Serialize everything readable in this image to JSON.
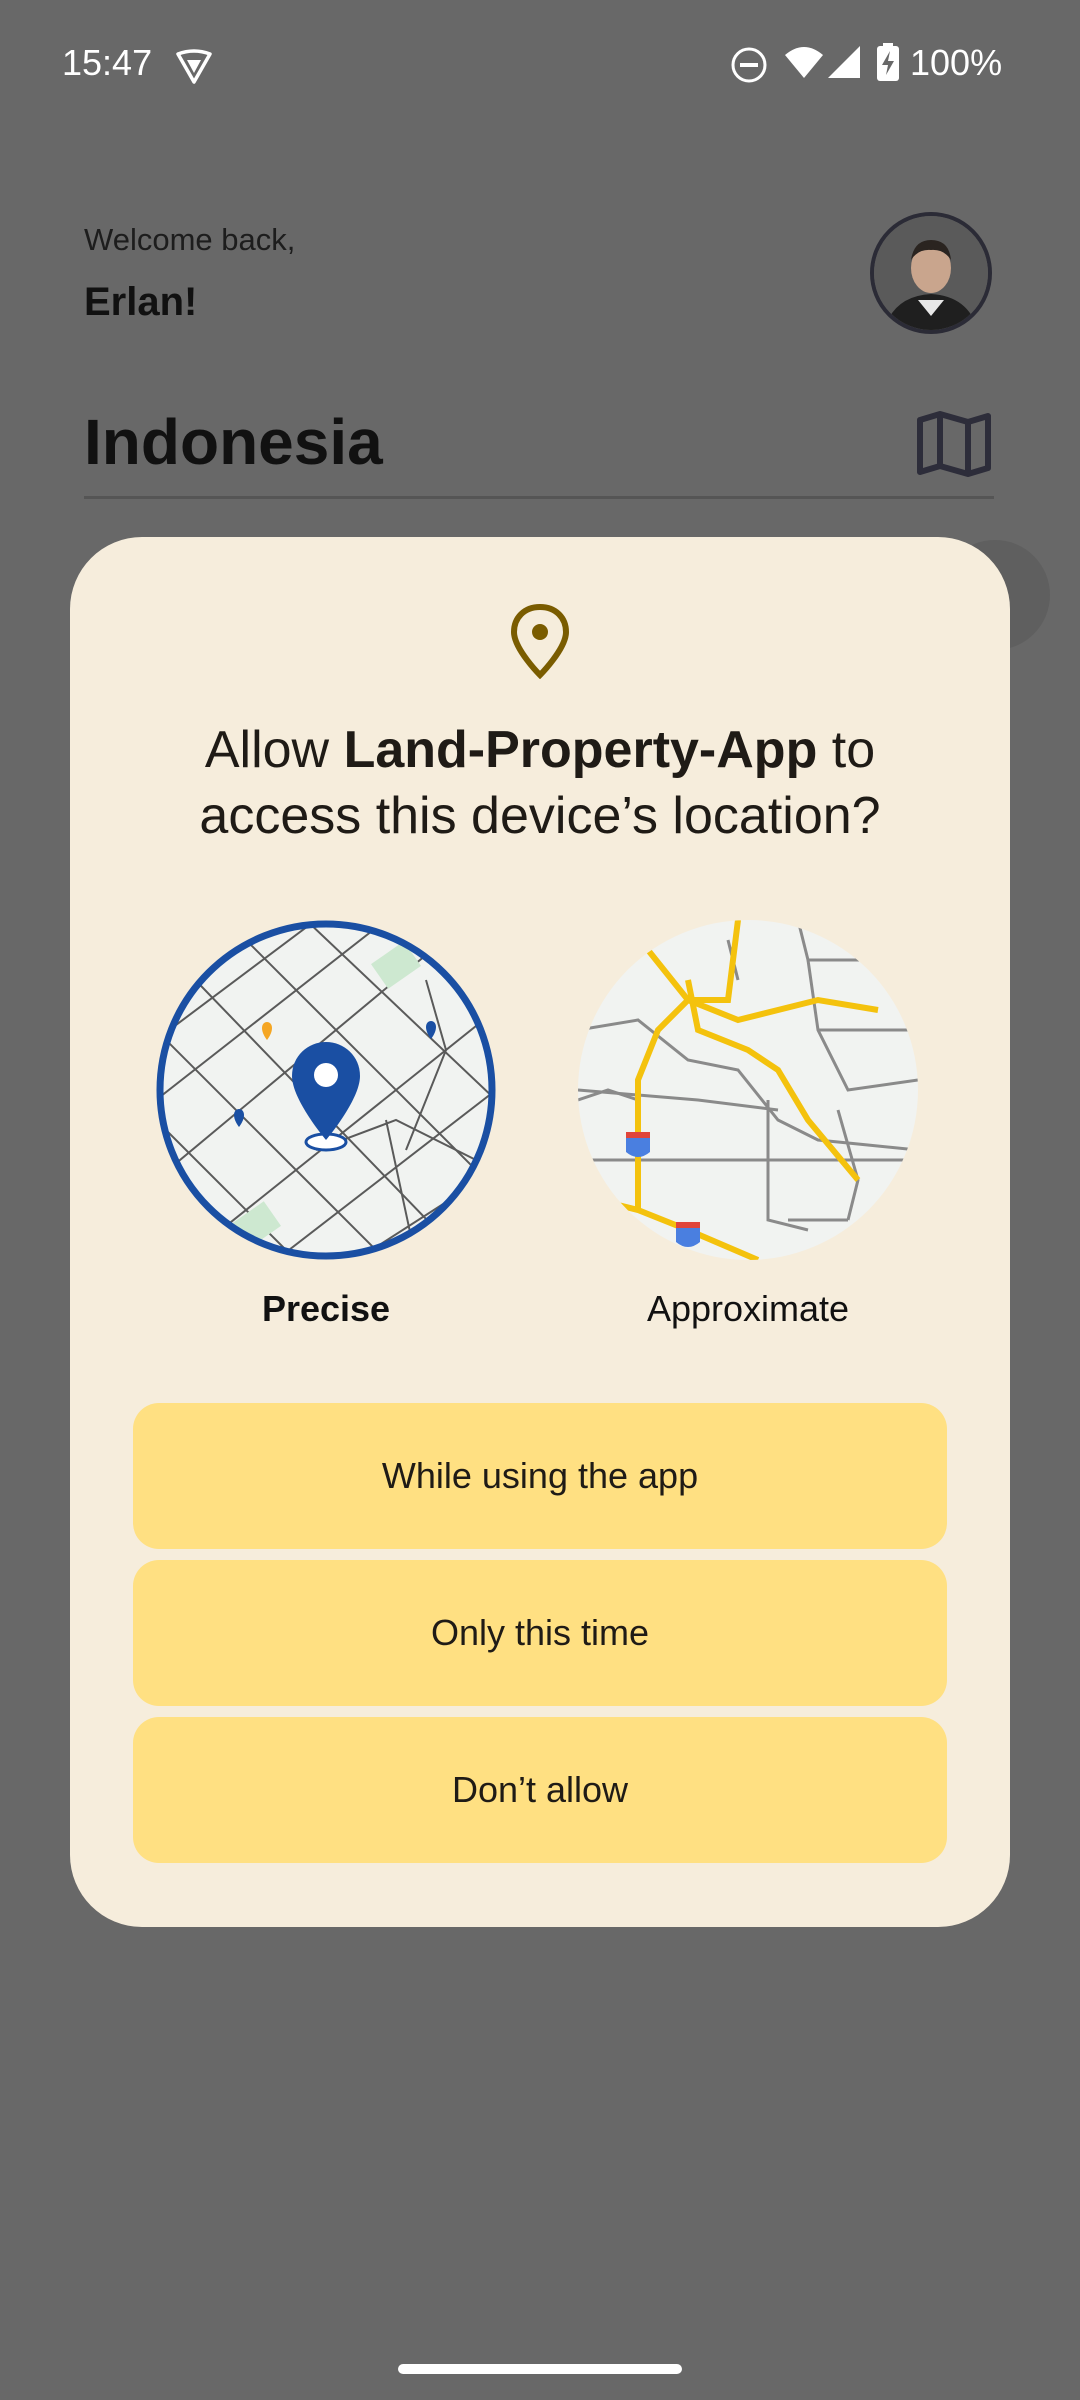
{
  "status_bar": {
    "time": "15:47",
    "battery": "100%",
    "icons": [
      "vpn-icon",
      "do-not-disturb-icon",
      "wifi-icon",
      "signal-icon",
      "battery-charging-icon"
    ]
  },
  "background": {
    "welcome": "Welcome back,",
    "user_name": "Erlan!",
    "region": "Indonesia",
    "map_icon": "map-icon"
  },
  "dialog": {
    "title_prefix": "Allow ",
    "app_name": "Land-Property-App",
    "title_suffix": " to access this device’s location?",
    "options": [
      {
        "label": "Precise",
        "selected": true
      },
      {
        "label": "Approximate",
        "selected": false
      }
    ],
    "buttons": {
      "while_using": "While using the app",
      "only_this_time": "Only this time",
      "dont_allow": "Don’t allow"
    }
  },
  "colors": {
    "scrim": "#686868",
    "dialog_bg": "#f6eddc",
    "button_bg": "#ffe082",
    "location_icon": "#7a5c00",
    "precise_pin": "#1a4fa3",
    "approx_roads": "#f4c20d"
  }
}
